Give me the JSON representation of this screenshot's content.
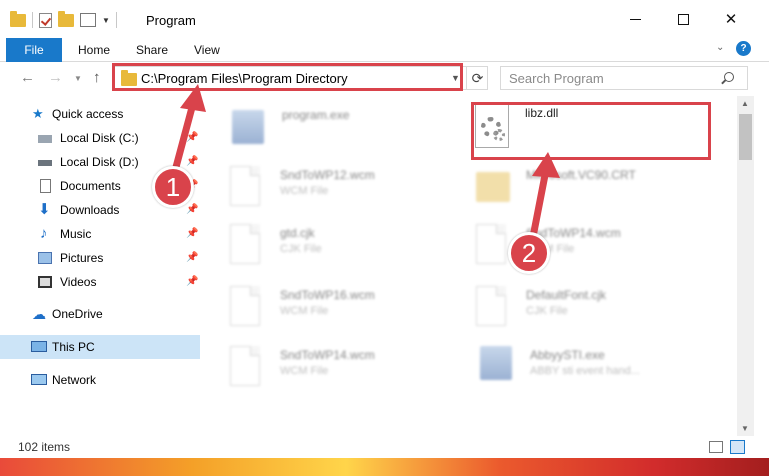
{
  "window": {
    "title": "Program"
  },
  "ribbon": {
    "tabs": [
      {
        "label": "File"
      },
      {
        "label": "Home"
      },
      {
        "label": "Share"
      },
      {
        "label": "View"
      }
    ]
  },
  "address": {
    "path": "C:\\Program Files\\Program Directory"
  },
  "search": {
    "placeholder": "Search Program"
  },
  "sidebar": {
    "items": [
      {
        "label": "Quick access"
      },
      {
        "label": "Local Disk (C:)"
      },
      {
        "label": "Local Disk (D:)"
      },
      {
        "label": "Documents"
      },
      {
        "label": "Downloads"
      },
      {
        "label": "Music"
      },
      {
        "label": "Pictures"
      },
      {
        "label": "Videos"
      },
      {
        "label": "OneDrive"
      },
      {
        "label": "This PC"
      },
      {
        "label": "Network"
      }
    ]
  },
  "files": [
    {
      "name": "program.exe",
      "type": ""
    },
    {
      "name": "libz.dll",
      "type": ""
    },
    {
      "name": "SndToWP12.wcm",
      "type": "WCM File"
    },
    {
      "name": "Microsoft.VC90.CRT",
      "type": ""
    },
    {
      "name": "gtd.cjk",
      "type": "CJK File"
    },
    {
      "name": "SndToWP14.wcm",
      "type": "WCM File"
    },
    {
      "name": "SndToWP16.wcm",
      "type": "WCM File"
    },
    {
      "name": "DefaultFont.cjk",
      "type": "CJK File"
    },
    {
      "name": "SndToWP14.wcm",
      "type": "WCM File"
    },
    {
      "name": "AbbyySTI.exe",
      "type": "ABBY sti event hand..."
    }
  ],
  "status": {
    "item_count": "102 items"
  },
  "annotations": {
    "step1": "1",
    "step2": "2"
  },
  "colors": {
    "accent": "#1979ca",
    "highlight": "#d9434b",
    "selection": "#cce4f7"
  }
}
